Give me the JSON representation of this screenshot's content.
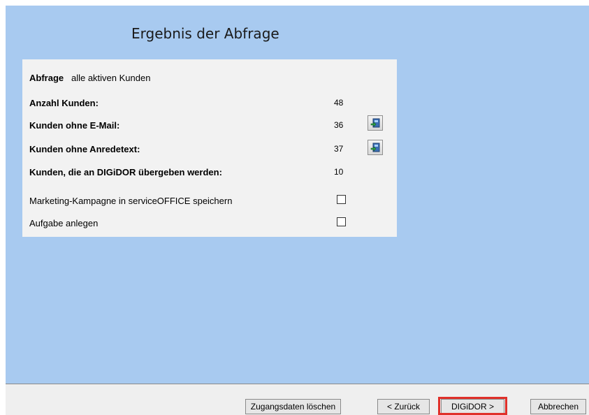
{
  "title": "Ergebnis der Abfrage",
  "query": {
    "label": "Abfrage",
    "value": "alle aktiven Kunden"
  },
  "rows": [
    {
      "label": "Anzahl Kunden:",
      "value": "48"
    },
    {
      "label": "Kunden ohne E-Mail:",
      "value": "36"
    },
    {
      "label": "Kunden ohne Anredetext:",
      "value": "37"
    },
    {
      "label": "Kunden, die an DIGiDOR übergeben werden:",
      "value": "10"
    }
  ],
  "options": [
    {
      "label": "Marketing-Kampagne in serviceOFFICE speichern",
      "checked": false
    },
    {
      "label": "Aufgabe anlegen",
      "checked": false
    }
  ],
  "buttons": {
    "delete_credentials": "Zugangsdaten löschen",
    "back": "< Zurück",
    "digidor": "DIGiDOR >",
    "cancel": "Abbrechen"
  },
  "icons": [
    "export-icon",
    "export-icon"
  ],
  "colors": {
    "background": "#a8caf0",
    "panel": "#f2f2f2",
    "highlight": "#e0302a"
  }
}
